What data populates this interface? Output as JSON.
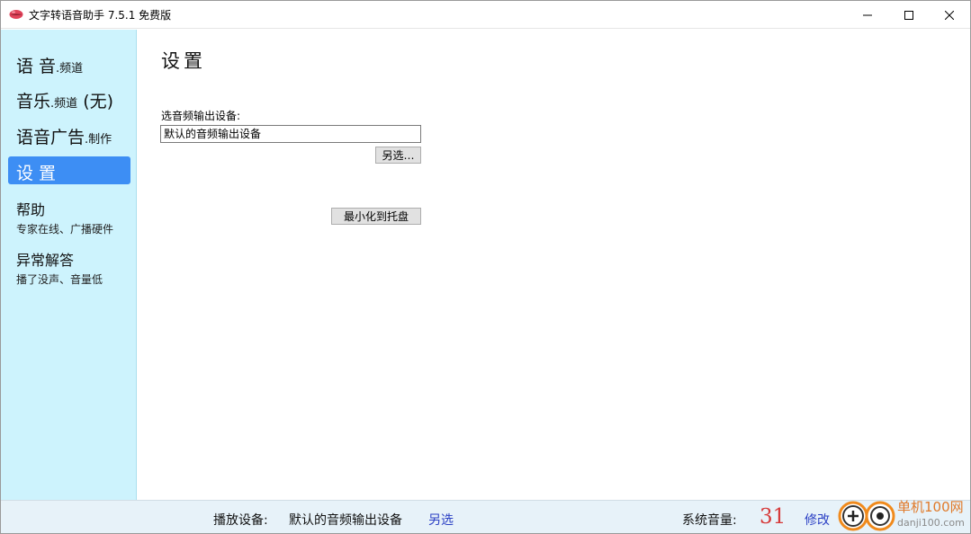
{
  "window": {
    "title": "文字转语音助手 7.5.1 免费版"
  },
  "sidebar": {
    "items": [
      {
        "label_main": "语 音",
        "label_sub": ".频道"
      },
      {
        "label_main": "音乐",
        "label_sub": ".频道",
        "label_tail": "(无)"
      },
      {
        "label_main": "语音广告",
        "label_sub": ".制作"
      },
      {
        "label_main": "设 置"
      }
    ],
    "help": {
      "title": "帮助",
      "subtitle": "专家在线、广播硬件"
    },
    "faq": {
      "title": "异常解答",
      "subtitle": "播了没声、音量低"
    }
  },
  "main": {
    "page_title": "设置",
    "device_label": "选音频输出设备:",
    "device_value": "默认的音频输出设备",
    "browse_button": "另选…",
    "minimize_tray_button": "最小化到托盘"
  },
  "status": {
    "device_label": "播放设备:",
    "device_value": "默认的音频输出设备",
    "device_change": "另选",
    "volume_label": "系统音量:",
    "volume_value": "31",
    "volume_edit": "修改"
  },
  "watermark": {
    "text_cn": "单机100网",
    "text_url": "danji100.com"
  },
  "colors": {
    "sidebar_bg": "#cdf3fd",
    "active_nav": "#3d8ef4",
    "status_bg": "#e7f2f9",
    "volume": "#d63a3a",
    "link": "#2a3fc4"
  },
  "icons": {
    "app": "lips-icon",
    "minimize": "minimize-icon",
    "maximize": "maximize-icon",
    "close": "close-icon"
  }
}
